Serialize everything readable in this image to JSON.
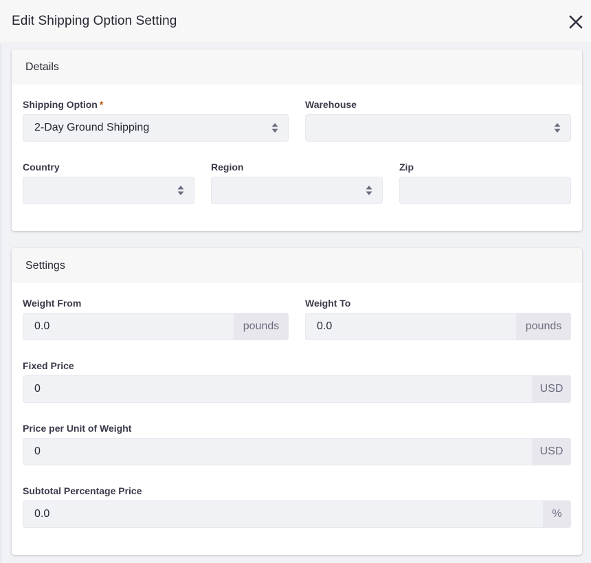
{
  "modal": {
    "title": "Edit Shipping Option Setting",
    "close_icon": "close-icon"
  },
  "details": {
    "title": "Details",
    "shipping_option": {
      "label": "Shipping Option",
      "required_mark": "*",
      "value": "2-Day Ground Shipping"
    },
    "warehouse": {
      "label": "Warehouse",
      "value": ""
    },
    "country": {
      "label": "Country",
      "value": ""
    },
    "region": {
      "label": "Region",
      "value": ""
    },
    "zip": {
      "label": "Zip",
      "value": ""
    }
  },
  "settings": {
    "title": "Settings",
    "weight_from": {
      "label": "Weight From",
      "value": "0.0",
      "unit": "pounds"
    },
    "weight_to": {
      "label": "Weight To",
      "value": "0.0",
      "unit": "pounds"
    },
    "fixed_price": {
      "label": "Fixed Price",
      "value": "0",
      "unit": "USD"
    },
    "price_per_unit_weight": {
      "label": "Price per Unit of Weight",
      "value": "0",
      "unit": "USD"
    },
    "subtotal_percentage_price": {
      "label": "Subtotal Percentage Price",
      "value": "0.0",
      "unit": "%"
    }
  },
  "colors": {
    "required": "#b95000",
    "input_bg": "#f1f2f5",
    "addon_bg": "#e7e7ed",
    "header_bg": "#f7f7f8"
  }
}
